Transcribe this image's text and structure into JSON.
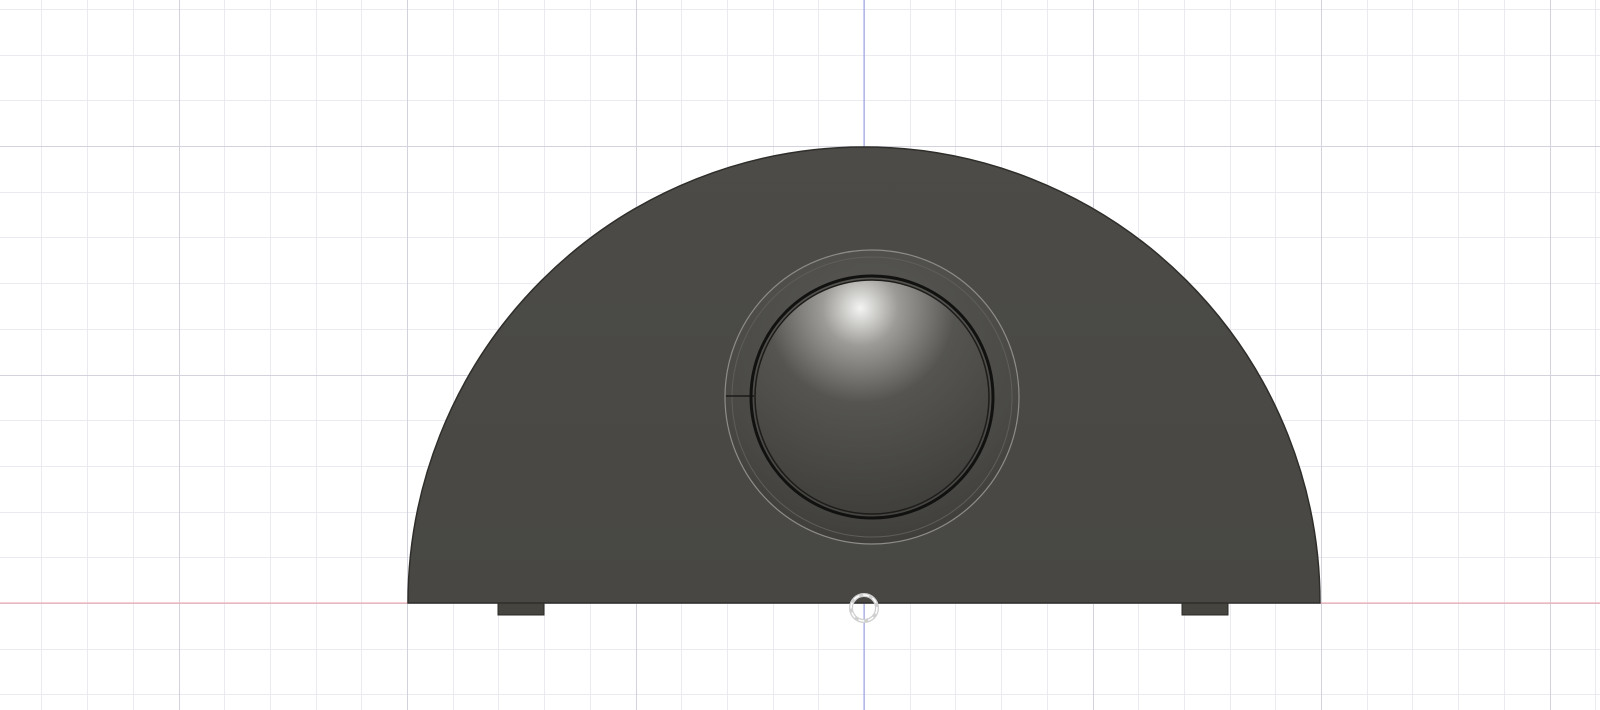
{
  "viewport": {
    "view": "front",
    "grid_visible": true,
    "colors": {
      "background": "#ffffff",
      "grid_minor": "#eaeaf0",
      "grid_major": "#d3d3de",
      "axis_horizontal": "#f0a0a8",
      "axis_vertical": "#9aa0e8",
      "body": "#4a4945",
      "body_edge": "#2f2e2b",
      "dome_highlight": "#f4f4f2",
      "dome_dark": "#2b2a28"
    },
    "model": {
      "name": "",
      "parts": [
        "half-round-base",
        "button-ring",
        "dome-button",
        "foot-left",
        "foot-right"
      ]
    },
    "icons": {
      "origin": "origin-marker-icon"
    }
  }
}
